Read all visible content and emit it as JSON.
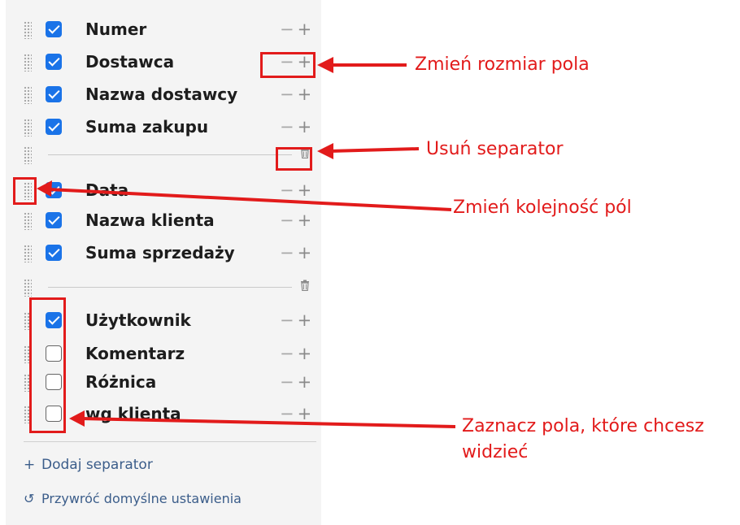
{
  "fields": [
    {
      "label": "Numer",
      "checked": true
    },
    {
      "label": "Dostawca",
      "checked": true
    },
    {
      "label": "Nazwa dostawcy",
      "checked": true
    },
    {
      "label": "Suma zakupu",
      "checked": true
    },
    {
      "label": "Data",
      "checked": true
    },
    {
      "label": "Nazwa klienta",
      "checked": true
    },
    {
      "label": "Suma sprzedaży",
      "checked": true
    },
    {
      "label": "Użytkownik",
      "checked": true
    },
    {
      "label": "Komentarz",
      "checked": false
    },
    {
      "label": "Różnica",
      "checked": false
    },
    {
      "label": "wg klienta",
      "checked": false
    }
  ],
  "controls": {
    "minus": "−",
    "plus": "+"
  },
  "actions": {
    "add_separator": "Dodaj separator",
    "add_icon": "plus-icon",
    "reset_defaults": "Przywróć domyślne ustawienia",
    "reset_icon": "restore-icon"
  },
  "annotations": {
    "resize": "Zmień rozmiar pola",
    "remove_separator": "Usuń separator",
    "reorder": "Zmień kolejność pól",
    "select_line1": "Zaznacz pola, które chcesz",
    "select_line2": "widzieć"
  },
  "colors": {
    "annotation": "#e21b1b",
    "checkbox_checked": "#1a73e8",
    "link": "#3b5d8a"
  }
}
